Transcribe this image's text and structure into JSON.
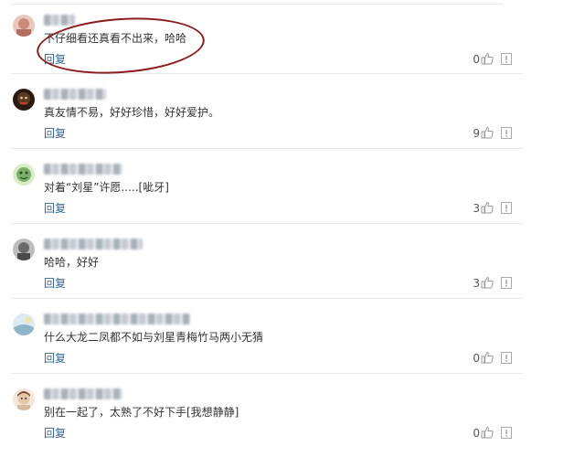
{
  "comments": [
    {
      "name": "网友",
      "text": "不仔细看还真看不出来，哈哈",
      "reply": "回复",
      "likes": "0",
      "avatar_color": "#c98a7a"
    },
    {
      "name": "网友",
      "text": "真友情不易，好好珍惜，好好爱护。",
      "reply": "回复",
      "likes": "9",
      "avatar_color": "#4a2a1a"
    },
    {
      "name": "网友",
      "text": "对着“刘星”许愿.....[呲牙]",
      "reply": "回复",
      "likes": "3",
      "avatar_color": "#7ab06a"
    },
    {
      "name": "网友",
      "text": "哈哈，好好",
      "reply": "回复",
      "likes": "3",
      "avatar_color": "#6a6a6a"
    },
    {
      "name": "网友",
      "text": "什么大龙二凤都不如与刘星青梅竹马两小无猜",
      "reply": "回复",
      "likes": "0",
      "avatar_color": "#8fb6c8"
    },
    {
      "name": "网友",
      "text": "别在一起了，太熟了不好下手[我想静静]",
      "reply": "回复",
      "likes": "0",
      "avatar_color": "#d9b9a0"
    }
  ],
  "colors": {
    "reply_link": "#336699",
    "highlight_ellipse": "#8b1a1a",
    "divider": "#e8e8e8"
  },
  "icons": {
    "like": "thumbs-up-icon",
    "report": "report-icon"
  }
}
